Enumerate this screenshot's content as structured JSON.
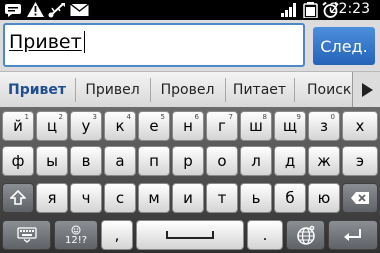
{
  "status_bar": {
    "time": "22:23",
    "icons": [
      "sms-icon",
      "warning-icon",
      "usb-icon",
      "mail-icon",
      "signal-icon",
      "battery-icon",
      "alarm-icon"
    ]
  },
  "input": {
    "value": "Привет",
    "action_label": "След."
  },
  "suggestions": [
    "Привет",
    "Привел",
    "Провел",
    "Питает",
    "Поиски"
  ],
  "keyboard": {
    "row1": [
      "й",
      "ц",
      "у",
      "к",
      "е",
      "н",
      "г",
      "ш",
      "щ",
      "з",
      "х"
    ],
    "row1_sub": [
      "1",
      "2",
      "3",
      "4",
      "5",
      "6",
      "7",
      "8",
      "9",
      "0",
      ""
    ],
    "row2": [
      "ф",
      "ы",
      "в",
      "а",
      "п",
      "р",
      "о",
      "л",
      "д",
      "ж",
      "э"
    ],
    "row3": [
      "я",
      "ч",
      "с",
      "м",
      "и",
      "т",
      "ь",
      "б",
      "ю"
    ],
    "symbols_label": "12!?",
    "comma": ",",
    "period": "."
  },
  "colors": {
    "accent": "#2f74cc",
    "selected_suggestion": "#1f4f8e"
  }
}
